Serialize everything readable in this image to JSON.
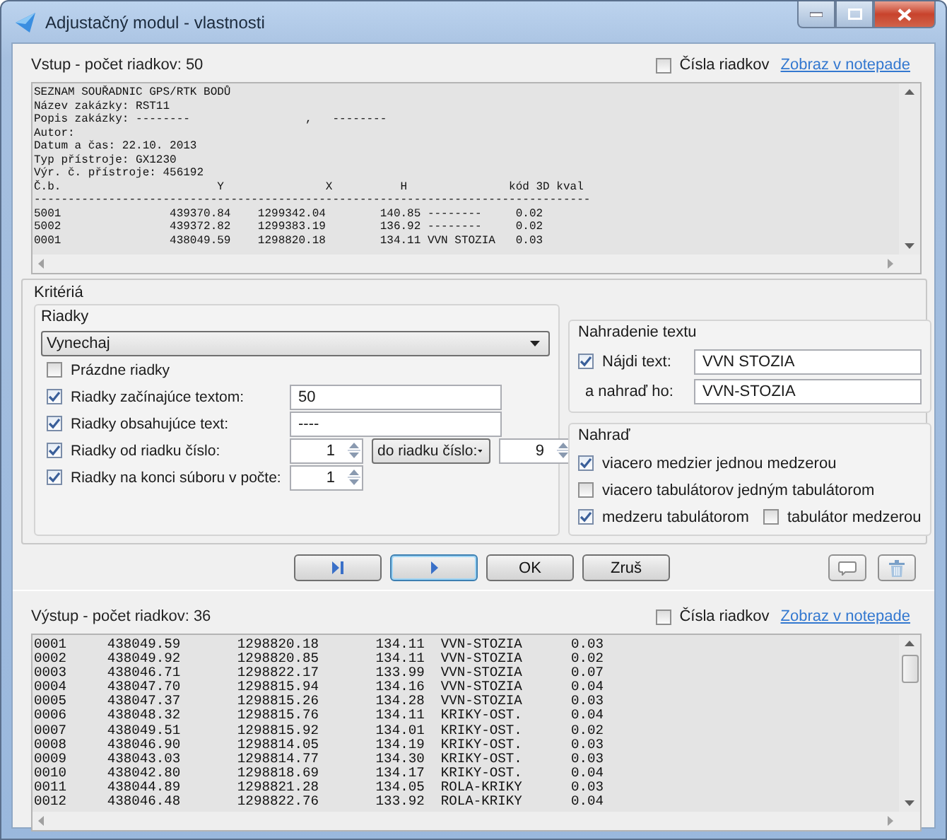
{
  "window": {
    "title": "Adjustačný modul - vlastnosti"
  },
  "input": {
    "label": "Vstup - počet riadkov: 50",
    "line_numbers": {
      "label": "Čísla riadkov",
      "checked": false
    },
    "link": "Zobraz v notepade",
    "lines": [
      "SEZNAM SOUŘADNIC GPS/RTK BODŮ",
      "Název zakázky: RST11",
      "Popis zakázky: --------                 ,   --------",
      "Autor:",
      "Datum a čas: 22.10. 2013",
      "Typ přístroje: GX1230",
      "Výr. č. přístroje: 456192",
      "Č.b.                       Y               X          H               kód 3D kval",
      "----------------------------------------------------------------------------------",
      "5001                439370.84    1299342.04        140.85 --------     0.02",
      "5002                439372.82    1299383.19        136.92 --------     0.02",
      "0001                438049.59    1298820.18        134.11 VVN STOZIA   0.03"
    ]
  },
  "criteria": {
    "title": "Kritériá",
    "rows": {
      "title": "Riadky",
      "mode": "Vynechaj",
      "options": [
        {
          "kind": "check",
          "label": "Prázdne riadky",
          "checked": false
        },
        {
          "kind": "text",
          "label": "Riadky začínajúce textom:",
          "checked": true,
          "value": "50"
        },
        {
          "kind": "text",
          "label": "Riadky obsahujúce text:",
          "checked": true,
          "value": "----"
        },
        {
          "kind": "range",
          "label": "Riadky od riadku číslo:",
          "checked": true,
          "value": "1",
          "range_mode": "do riadku číslo:",
          "end": "9"
        },
        {
          "kind": "spin",
          "label": "Riadky na konci súboru v počte:",
          "checked": true,
          "value": "1"
        }
      ]
    },
    "replace_text": {
      "title": "Nahradenie textu",
      "find": {
        "label": "Nájdi text:",
        "checked": true,
        "value": "VVN STOZIA"
      },
      "replace": {
        "label": "a nahraď ho:",
        "value": "VVN-STOZIA"
      }
    },
    "replace": {
      "title": "Nahraď",
      "rows": [
        [
          {
            "label": "viacero medzier jednou medzerou",
            "checked": true
          }
        ],
        [
          {
            "label": "viacero tabulátorov jedným tabulátorom",
            "checked": false
          }
        ],
        [
          {
            "label": "medzeru tabulátorom",
            "checked": true
          },
          {
            "label": "tabulátor medzerou",
            "checked": false
          }
        ]
      ]
    }
  },
  "buttons": [
    {
      "kind": "skip-end",
      "focused": false
    },
    {
      "kind": "play",
      "focused": true
    },
    {
      "kind": "text",
      "label": "OK",
      "focused": false
    },
    {
      "kind": "text",
      "label": "Zruš",
      "focused": false
    }
  ],
  "tools": [
    {
      "kind": "comment"
    },
    {
      "kind": "trash"
    }
  ],
  "output": {
    "label": "Výstup - počet riadkov: 36",
    "line_numbers": {
      "label": "Čísla riadkov",
      "checked": false
    },
    "link": "Zobraz v notepade",
    "lines": [
      "0001     438049.59       1298820.18       134.11  VVN-STOZIA      0.03",
      "0002     438049.92       1298820.85       134.11  VVN-STOZIA      0.02",
      "0003     438046.71       1298822.17       133.99  VVN-STOZIA      0.07",
      "0004     438047.70       1298815.94       134.16  VVN-STOZIA      0.04",
      "0005     438047.37       1298815.26       134.28  VVN-STOZIA      0.03",
      "0006     438048.32       1298815.76       134.11  KRIKY-OST.      0.04",
      "0007     438049.51       1298815.92       134.01  KRIKY-OST.      0.02",
      "0008     438046.90       1298814.05       134.19  KRIKY-OST.      0.03",
      "0009     438043.03       1298814.77       134.30  KRIKY-OST.      0.03",
      "0010     438042.80       1298818.69       134.17  KRIKY-OST.      0.04",
      "0011     438044.89       1298821.28       134.05  ROLA-KRIKY      0.03",
      "0012     438046.48       1298822.76       133.92  ROLA-KRIKY      0.04"
    ]
  }
}
